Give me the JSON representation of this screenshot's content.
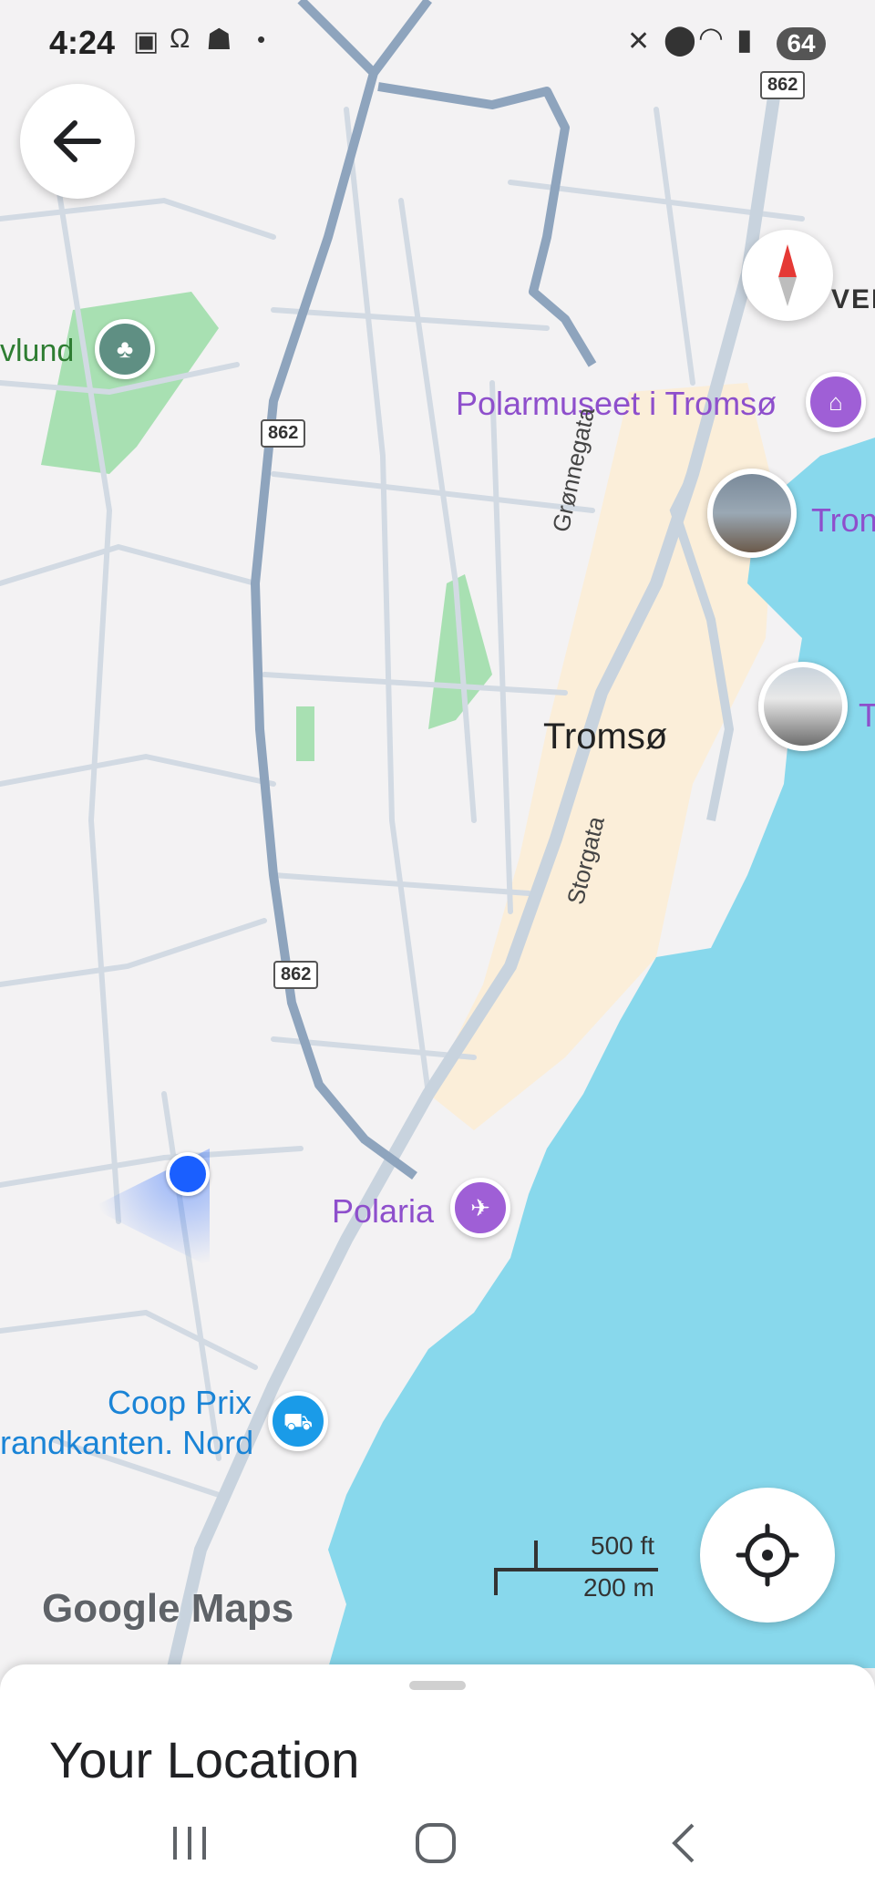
{
  "status_bar": {
    "time": "4:24",
    "battery": "64",
    "left_icons": [
      "screenshot-icon",
      "headphones-icon",
      "snapchat-icon",
      "dot-icon"
    ],
    "right_icons": [
      "mute-icon",
      "location-icon",
      "wifi-icon",
      "signal-icon"
    ]
  },
  "map": {
    "city_label": "Tromsø",
    "streets": [
      "Grønnegata",
      "Storgata"
    ],
    "route_shields": [
      "862",
      "862",
      "862",
      "862"
    ],
    "places": {
      "park": "vlund",
      "museum": "Polarmuseet i Tromsø",
      "photo_place_1": "Tron",
      "photo_place_2": "T",
      "aquarium": "Polaria",
      "shop_line1": "Coop Prix",
      "shop_line2": "randkanten. Nord",
      "top_right_fragment": "VEF"
    },
    "scale": {
      "imperial": "500 ft",
      "metric": "200 m"
    },
    "logo_text": "Google Maps",
    "colors": {
      "water": "#88d8ec",
      "land": "#f3f2f3",
      "downtown": "#fbeed9",
      "park": "#a8e0b2",
      "highway": "#8ea4bd",
      "road": "#d2dae3",
      "poi_purple": "#9f5fd6",
      "shop_blue": "#1a9be8",
      "location_dot": "#1a5fff"
    }
  },
  "controls": {
    "back_icon": "arrow-left-icon",
    "compass_icon": "compass-icon",
    "my_location_icon": "crosshair-icon"
  },
  "sheet": {
    "title": "Your Location"
  },
  "nav_bar": {
    "icons": [
      "recents-icon",
      "home-icon",
      "back-icon"
    ]
  }
}
